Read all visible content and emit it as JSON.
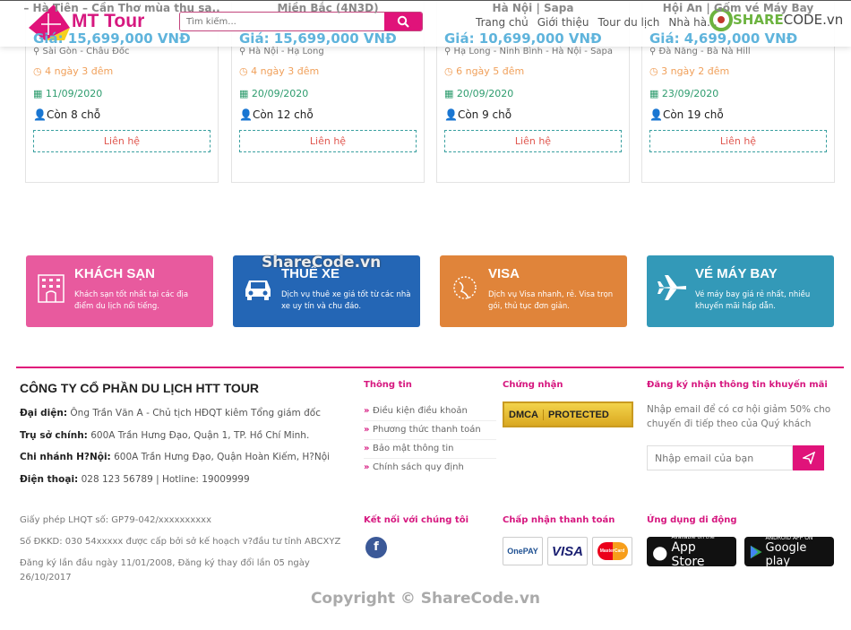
{
  "header": {
    "logo_text": "MT Tour",
    "search_placeholder": "Tìm kiếm...",
    "nav": [
      "Trang chủ",
      "Giới thiệu",
      "Tour du lịch",
      "Nhà hà..."
    ],
    "watermark_share": "SHARE",
    "watermark_code": "CODE",
    "watermark_vn": ".vn"
  },
  "tours": [
    {
      "title": "– Hà Tiên – Cần Thơ mùa thu sa..",
      "price": "Giá: 15,699,000 VNĐ",
      "location": "Sài Gòn - Châu Đốc",
      "duration": "4 ngày 3 đêm",
      "date": "11/09/2020",
      "seats": "Còn 8 chỗ",
      "button": "Liên hệ"
    },
    {
      "title": "Miền Bắc (4N3D)",
      "price": "Giá: 15,699,000 VNĐ",
      "location": "Hà Nội - Hạ Long",
      "duration": "4 ngày 3 đêm",
      "date": "20/09/2020",
      "seats": "Còn 12 chỗ",
      "button": "Liên hệ"
    },
    {
      "title": "Hà Nội | Sapa",
      "price": "Giá: 10,699,000 VNĐ",
      "location": "Hạ Long - Ninh Bình - Hà Nội - Sapa",
      "duration": "6 ngày 5 đêm",
      "date": "20/09/2020",
      "seats": "Còn 9 chỗ",
      "button": "Liên hệ"
    },
    {
      "title": "Hội An | Gốm vé Máy Bay",
      "price": "Giá: 4,699,000 VNĐ",
      "location": "Đà Nẵng - Bà Nà Hill",
      "duration": "3 ngày 2 đêm",
      "date": "23/09/2020",
      "seats": "Còn 19 chỗ",
      "button": "Liên hệ"
    }
  ],
  "services": [
    {
      "title": "KHÁCH SẠN",
      "desc": "Khách sạn tốt nhất tại các địa điểm du lịch nổi tiếng.",
      "color": "#e85a9e",
      "icon": "hotel-icon"
    },
    {
      "title": "THUÊ XE",
      "desc": "Dịch vụ thuê xe giá tốt từ các nhà xe uy tín và chu đáo.",
      "color": "#2466b5",
      "icon": "car-icon"
    },
    {
      "title": "VISA",
      "desc": "Dịch vụ Visa nhanh, rẻ. Visa trọn gói, thủ tục đơn giản.",
      "color": "#e0843a",
      "icon": "globe-icon"
    },
    {
      "title": "VÉ MÁY BAY",
      "desc": "Vé máy bay giá rẻ nhất, nhiều khuyến mãi hấp dẫn.",
      "color": "#3399b8",
      "icon": "plane-icon"
    }
  ],
  "service_watermark": "ShareCode.vn",
  "footer": {
    "company": "CÔNG TY CỔ PHẦN DU LỊCH HTT TOUR",
    "lines": [
      {
        "label": "Đại diện:",
        "value": " Ông Trần Văn A - Chủ tịch HĐQT kiêm Tổng giám đốc"
      },
      {
        "label": "Trụ sở chính:",
        "value": " 600A Trần Hưng Đạo, Quận 1, TP. Hồ Chí Minh."
      },
      {
        "label": "Chi nhánh H?Nội:",
        "value": " 600A Trần Hưng Đạo, Quận Hoàn Kiếm, H?Nội"
      },
      {
        "label": "Điện thoại:",
        "value": " 028 123 56789 | Hotline: 19009999"
      }
    ],
    "license": "Giấy phép LHQT số: GP79-042/xxxxxxxxxx",
    "business": "Số ĐKKD: 030 54xxxxx được cấp bởi sở kế hoạch v?đầu tư tỉnh ABCXYZ",
    "registered": "Đăng ký lần đầu ngày 11/01/2008, Đăng ký thay đổi lần 05 ngày",
    "registered2": "26/10/2017",
    "info_title": "Thông tin",
    "info_links": [
      "Điều kiện điều khoản",
      "Phương thức thanh toán",
      "Bảo mật thông tin",
      "Chính sách quy định"
    ],
    "cert_title": "Chứng nhận",
    "dmca": [
      "DMCA",
      "PROTECTED"
    ],
    "newsletter_title": "Đăng ký nhận thông tin khuyến mãi",
    "newsletter_desc": "Nhập email để có cơ hội giảm 50% cho chuyến đi tiếp theo của Quý khách",
    "email_placeholder": "Nhập email của bạn",
    "connect_title": "Kết nối với chúng tôi",
    "payment_title": "Chấp nhận thanh toán",
    "payments": [
      "OnePAY",
      "VISA",
      "MasterCard"
    ],
    "apps_title": "Ứng dụng di động",
    "appstore": {
      "small": "Available on the",
      "big": "App Store"
    },
    "googleplay": {
      "small": "ANDROID APP ON",
      "big": "Google play"
    },
    "copyright": "Copyright © ShareCode.vn"
  },
  "colors": {
    "accent": "#e0137a",
    "price": "#3aa6d8",
    "duration": "#f0a05a",
    "date": "#2e9c6e"
  }
}
